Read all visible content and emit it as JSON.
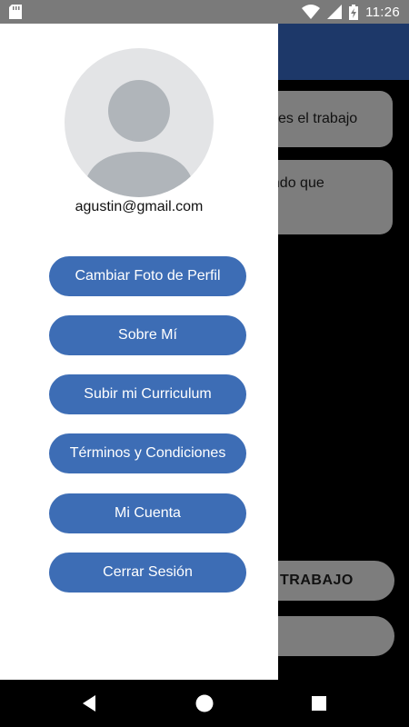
{
  "status_bar": {
    "time": "11:26",
    "icons": [
      "sd-card-icon",
      "wifi-icon",
      "signal-icon",
      "battery-charging-icon"
    ]
  },
  "background": {
    "card1_text": "es el trabajo",
    "card2_text": "ando que",
    "pill_text": "TRABAJO"
  },
  "drawer": {
    "email": "agustin@gmail.com",
    "menu": [
      {
        "label": "Cambiar Foto de Perfil"
      },
      {
        "label": "Sobre Mí"
      },
      {
        "label": "Subir mi Curriculum"
      },
      {
        "label": "Términos y Condiciones"
      },
      {
        "label": "Mi Cuenta"
      },
      {
        "label": "Cerrar Sesión"
      }
    ]
  },
  "colors": {
    "button": "#3d6db5",
    "app_bar": "#1d3869",
    "status_bar": "#7a7a7a"
  },
  "nav_bar": {
    "icons": [
      "back-icon",
      "home-icon",
      "recents-icon"
    ]
  }
}
